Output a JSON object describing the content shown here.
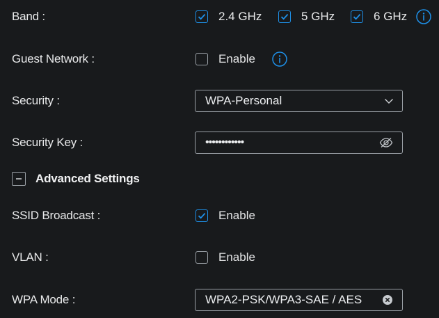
{
  "band": {
    "label": "Band :",
    "options": [
      {
        "label": "2.4 GHz",
        "checked": true
      },
      {
        "label": "5 GHz",
        "checked": true
      },
      {
        "label": "6 GHz",
        "checked": true
      }
    ]
  },
  "guest_network": {
    "label": "Guest Network :",
    "option_label": "Enable",
    "checked": false
  },
  "security": {
    "label": "Security :",
    "value": "WPA-Personal"
  },
  "security_key": {
    "label": "Security Key :",
    "value": "••••••••••••"
  },
  "advanced": {
    "title": "Advanced Settings"
  },
  "ssid_broadcast": {
    "label": "SSID Broadcast :",
    "option_label": "Enable",
    "checked": true
  },
  "vlan": {
    "label": "VLAN :",
    "option_label": "Enable",
    "checked": false
  },
  "wpa_mode": {
    "label": "WPA Mode :",
    "value": "WPA2-PSK/WPA3-SAE / AES"
  },
  "colors": {
    "accent": "#1e90e8",
    "background": "#181a1c",
    "border": "#9aa0a6",
    "text": "#e6e7e8"
  }
}
